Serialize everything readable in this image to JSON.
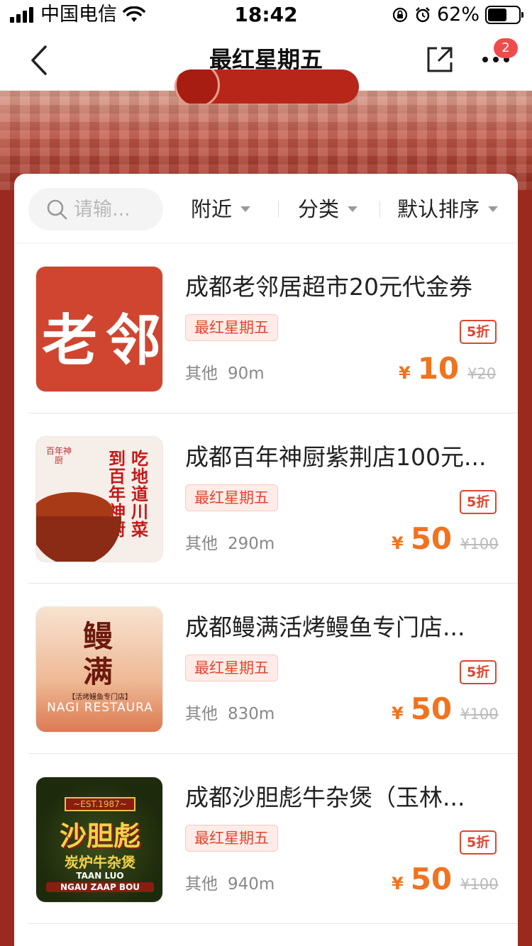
{
  "status_bar": {
    "carrier": "中国电信",
    "time": "18:42",
    "battery": "62%"
  },
  "nav": {
    "title": "最红星期五",
    "badge": "2"
  },
  "search": {
    "placeholder": "请输..."
  },
  "filters": [
    "附近",
    "分类",
    "默认排序"
  ],
  "items": [
    {
      "title": "成都老邻居超市20元代金券",
      "tag": "最红星期五",
      "category": "其他",
      "distance": "90m",
      "currency": "¥",
      "price": "10",
      "original": "¥20",
      "discount": "5折",
      "image_text": "老邻"
    },
    {
      "title": "成都百年神厨紫荆店100元...",
      "tag": "最红星期五",
      "category": "其他",
      "distance": "290m",
      "currency": "¥",
      "price": "50",
      "original": "¥100",
      "discount": "5折",
      "image_text": [
        "吃地道川菜",
        "到百年神厨"
      ],
      "image_logo": "百年神厨"
    },
    {
      "title": "成都鳗满活烤鳗鱼专门店...",
      "tag": "最红星期五",
      "category": "其他",
      "distance": "830m",
      "currency": "¥",
      "price": "50",
      "original": "¥100",
      "discount": "5折",
      "image_text": [
        "鳗",
        "满"
      ],
      "image_sub": "【活烤鳗鱼专门店】",
      "image_eng": "NAGI RESTAURA"
    },
    {
      "title": "成都沙胆彪牛杂煲（玉林...",
      "tag": "最红星期五",
      "category": "其他",
      "distance": "940m",
      "currency": "¥",
      "price": "50",
      "original": "¥100",
      "discount": "5折",
      "image_est": "~EST.1987~",
      "image_text": "沙胆彪",
      "image_sub": "炭炉牛杂煲",
      "image_eng1": "TAAN LUO",
      "image_eng2": "NGAU ZAAP BOU"
    }
  ]
}
